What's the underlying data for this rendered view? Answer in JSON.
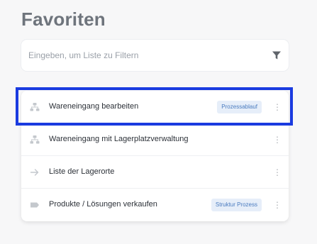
{
  "header": {
    "title": "Favoriten"
  },
  "filter": {
    "placeholder": "Eingeben, um Liste zu Filtern",
    "icon": "filter-icon"
  },
  "list": {
    "items": [
      {
        "label": "Wareneingang bearbeiten",
        "badge": "Prozessablauf",
        "icon": "process-icon"
      },
      {
        "label": "Wareneingang mit Lagerplatzverwaltung",
        "badge": "",
        "icon": "process-icon"
      },
      {
        "label": "Liste der Lagerorte",
        "badge": "",
        "icon": "arrow-right-icon"
      },
      {
        "label": "Produkte / Lösungen verkaufen",
        "badge": "Struktur Prozess",
        "icon": "tag-icon"
      }
    ]
  },
  "colors": {
    "highlight": "#1a3be0",
    "badge_bg": "#e6eef9",
    "badge_text": "#4a7bbf",
    "title": "#6e747c"
  }
}
